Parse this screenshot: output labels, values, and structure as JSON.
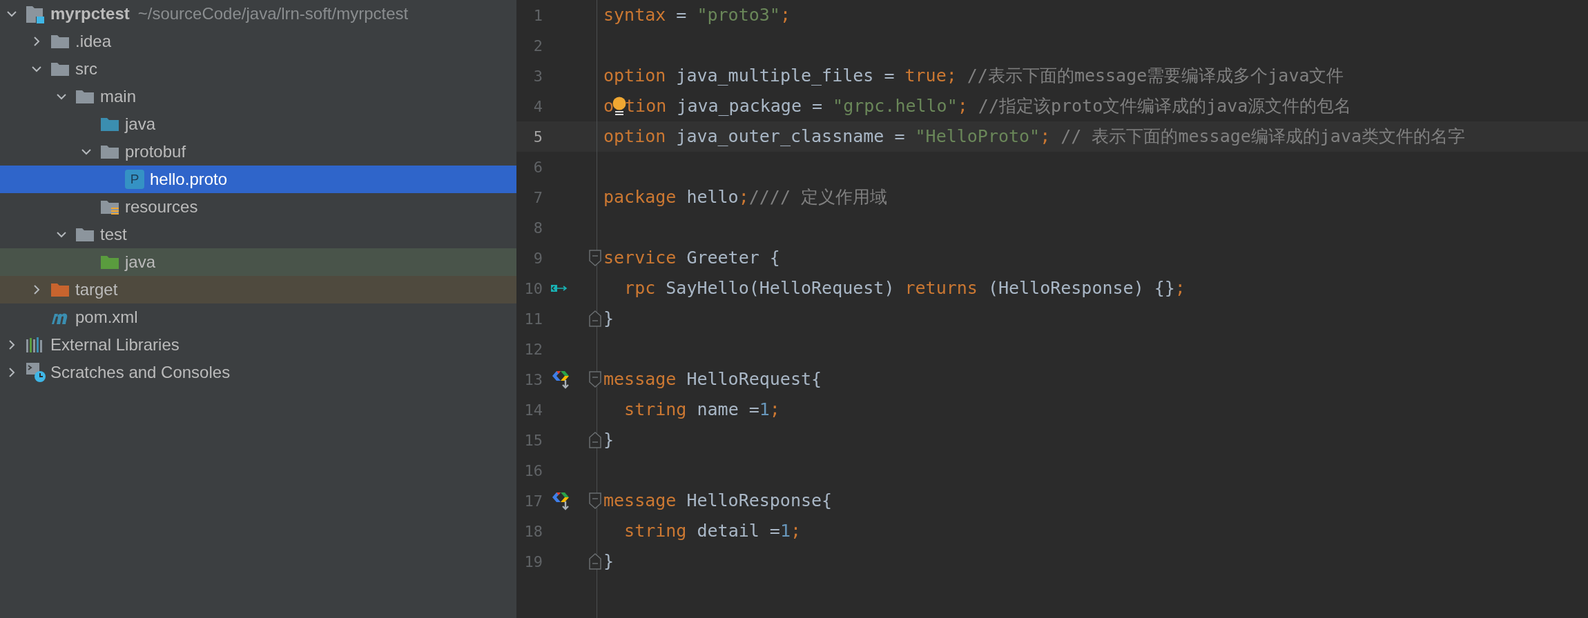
{
  "project_tree": [
    {
      "kind": "project",
      "label": "myrpctest",
      "path": "~/sourceCode/java/lrn-soft/myrpctest",
      "expanded": true,
      "selected": false,
      "children": [
        {
          "kind": "folder",
          "label": ".idea",
          "expanded": false,
          "selected": false
        },
        {
          "kind": "folder",
          "label": "src",
          "expanded": true,
          "selected": false,
          "children": [
            {
              "kind": "folder",
              "label": "main",
              "expanded": true,
              "selected": false,
              "children": [
                {
                  "kind": "source-folder",
                  "label": "java",
                  "selected": false
                },
                {
                  "kind": "folder",
                  "label": "protobuf",
                  "expanded": true,
                  "selected": false,
                  "children": [
                    {
                      "kind": "proto-file",
                      "label": "hello.proto",
                      "icon_letter": "P",
                      "selected": true
                    }
                  ]
                },
                {
                  "kind": "resources-folder",
                  "label": "resources",
                  "selected": false
                }
              ]
            },
            {
              "kind": "folder",
              "label": "test",
              "expanded": true,
              "selected": false,
              "children": [
                {
                  "kind": "test-folder",
                  "label": "java",
                  "selected": false
                }
              ]
            }
          ]
        },
        {
          "kind": "excluded-folder",
          "label": "target",
          "expanded": false,
          "selected": false
        },
        {
          "kind": "maven-file",
          "label": "pom.xml",
          "selected": false
        }
      ]
    },
    {
      "kind": "libraries",
      "label": "External Libraries",
      "expanded": false,
      "selected": false
    },
    {
      "kind": "scratches",
      "label": "Scratches and Consoles",
      "expanded": false,
      "selected": false
    }
  ],
  "editor": {
    "lines": [
      {
        "number": "1",
        "current": false,
        "tokens": [
          {
            "kind": "keyword",
            "text": "syntax"
          },
          {
            "kind": "plain",
            "text": " = "
          },
          {
            "kind": "string",
            "text": "\"proto3\""
          },
          {
            "kind": "keyword",
            "text": ";"
          }
        ]
      },
      {
        "number": "2",
        "current": false
      },
      {
        "number": "3",
        "current": false,
        "tokens": [
          {
            "kind": "keyword",
            "text": "option"
          },
          {
            "kind": "plain",
            "text": " java_multiple_files = "
          },
          {
            "kind": "keyword",
            "text": "true;"
          },
          {
            "kind": "comment",
            "text": " //表示下面的message需要编译成多个java文件"
          }
        ]
      },
      {
        "number": "4",
        "current": false,
        "tokens": [
          {
            "kind": "keyword",
            "text": "o"
          },
          {
            "kind": "bulb"
          },
          {
            "kind": "keyword",
            "text": "tion"
          },
          {
            "kind": "plain",
            "text": " java_package = "
          },
          {
            "kind": "string",
            "text": "\"grpc.hello\""
          },
          {
            "kind": "keyword",
            "text": ";"
          },
          {
            "kind": "comment",
            "text": " //指定该proto文件编译成的java源文件的包名"
          }
        ]
      },
      {
        "number": "5",
        "current": true,
        "tokens": [
          {
            "kind": "keyword",
            "text": "option"
          },
          {
            "kind": "plain",
            "text": " java_outer_classname = "
          },
          {
            "kind": "string",
            "text": "\"HelloProto\""
          },
          {
            "kind": "keyword",
            "text": ";"
          },
          {
            "kind": "comment",
            "text": " // 表示下面的message编译成的java类文件的名字"
          }
        ]
      },
      {
        "number": "6",
        "current": false
      },
      {
        "number": "7",
        "current": false,
        "tokens": [
          {
            "kind": "keyword",
            "text": "package"
          },
          {
            "kind": "plain",
            "text": " hello"
          },
          {
            "kind": "keyword",
            "text": ";"
          },
          {
            "kind": "comment",
            "text": "//// 定义作用域"
          }
        ]
      },
      {
        "number": "8",
        "current": false
      },
      {
        "number": "9",
        "current": false,
        "fold_open": true,
        "tokens": [
          {
            "kind": "keyword",
            "text": "service"
          },
          {
            "kind": "plain",
            "text": " Greeter {"
          }
        ]
      },
      {
        "number": "10",
        "current": false,
        "implements_marker": true,
        "tokens": [
          {
            "kind": "keyword",
            "text": "  rpc"
          },
          {
            "kind": "plain",
            "text": " SayHello(HelloRequest) "
          },
          {
            "kind": "keyword",
            "text": "returns"
          },
          {
            "kind": "plain",
            "text": " (HelloResponse) {}"
          },
          {
            "kind": "keyword",
            "text": ";"
          }
        ]
      },
      {
        "number": "11",
        "current": false,
        "fold_close": true,
        "tokens": [
          {
            "kind": "plain",
            "text": "}"
          }
        ]
      },
      {
        "number": "12",
        "current": false
      },
      {
        "number": "13",
        "current": false,
        "fold_open": true,
        "proto_marker": true,
        "tokens": [
          {
            "kind": "keyword",
            "text": "message"
          },
          {
            "kind": "plain",
            "text": " HelloRequest{"
          }
        ]
      },
      {
        "number": "14",
        "current": false,
        "tokens": [
          {
            "kind": "keyword",
            "text": "  string"
          },
          {
            "kind": "plain",
            "text": " name ="
          },
          {
            "kind": "number",
            "text": "1"
          },
          {
            "kind": "keyword",
            "text": ";"
          }
        ]
      },
      {
        "number": "15",
        "current": false,
        "fold_close": true,
        "tokens": [
          {
            "kind": "plain",
            "text": "}"
          }
        ]
      },
      {
        "number": "16",
        "current": false
      },
      {
        "number": "17",
        "current": false,
        "fold_open": true,
        "proto_marker": true,
        "tokens": [
          {
            "kind": "keyword",
            "text": "message"
          },
          {
            "kind": "plain",
            "text": " HelloResponse{"
          }
        ]
      },
      {
        "number": "18",
        "current": false,
        "tokens": [
          {
            "kind": "keyword",
            "text": "  string"
          },
          {
            "kind": "plain",
            "text": " detail ="
          },
          {
            "kind": "number",
            "text": "1"
          },
          {
            "kind": "keyword",
            "text": ";"
          }
        ]
      },
      {
        "number": "19",
        "current": false,
        "fold_close": true,
        "tokens": [
          {
            "kind": "plain",
            "text": "}"
          }
        ]
      }
    ]
  }
}
